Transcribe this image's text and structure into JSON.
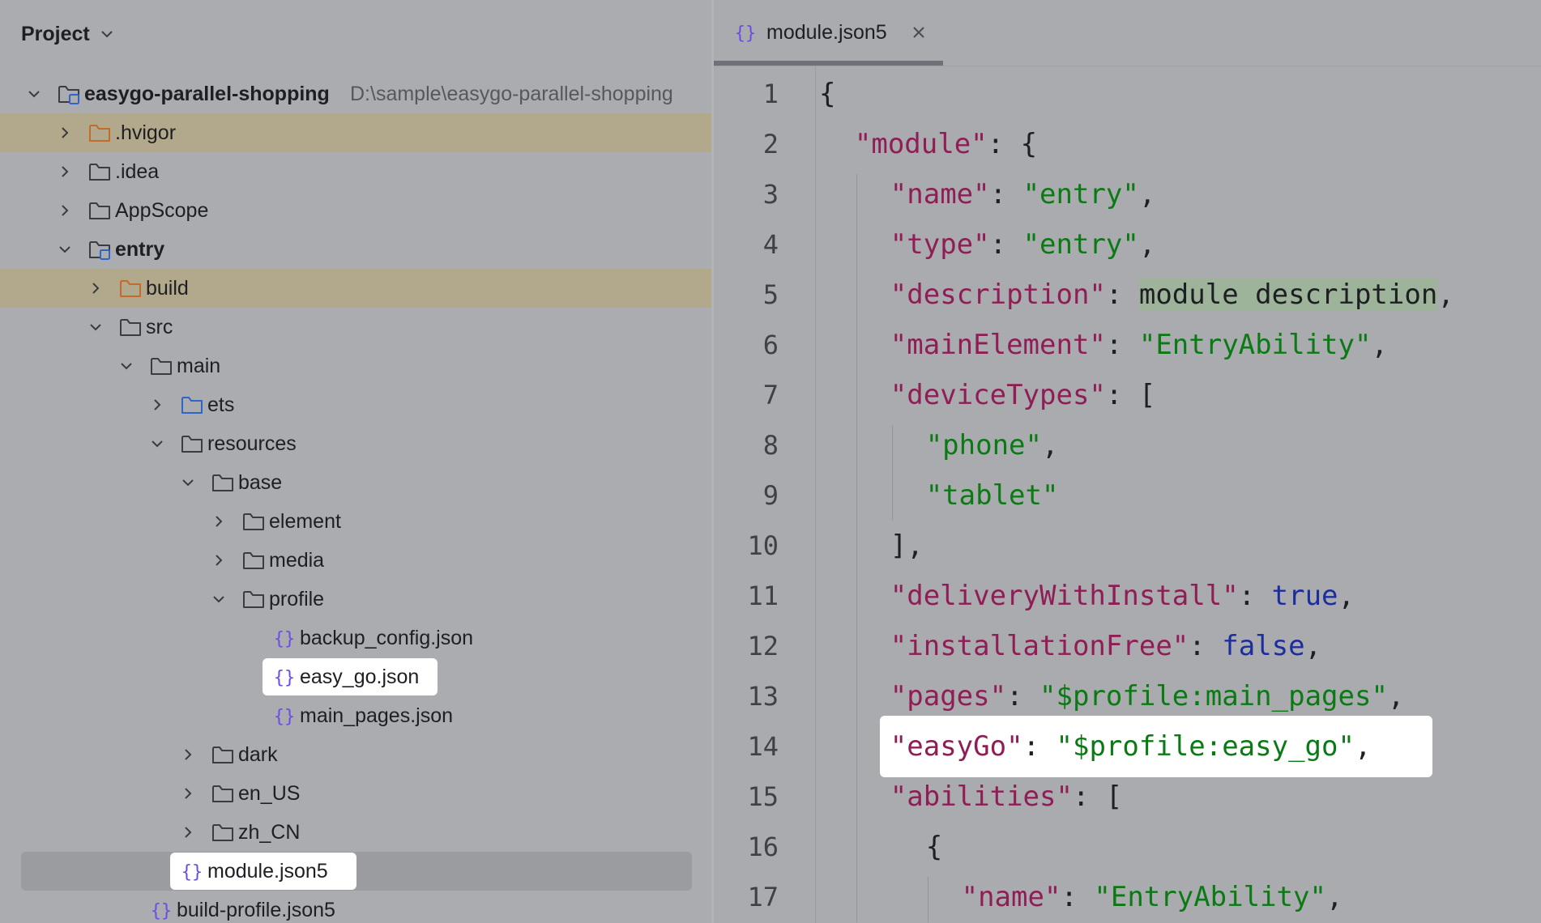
{
  "project_panel": {
    "title": "Project",
    "tree": [
      {
        "label": "easygo-parallel-shopping",
        "path": "D:\\sample\\easygo-parallel-shopping",
        "icon": "module-folder-icon",
        "expanded": true
      },
      {
        "label": ".hvigor",
        "icon": "excluded-folder-icon",
        "expanded": false
      },
      {
        "label": ".idea",
        "icon": "folder-icon",
        "expanded": false
      },
      {
        "label": "AppScope",
        "icon": "folder-icon",
        "expanded": false
      },
      {
        "label": "entry",
        "icon": "module-folder-icon",
        "expanded": true
      },
      {
        "label": "build",
        "icon": "excluded-folder-icon",
        "expanded": false
      },
      {
        "label": "src",
        "icon": "folder-icon",
        "expanded": true
      },
      {
        "label": "main",
        "icon": "folder-icon",
        "expanded": true
      },
      {
        "label": "ets",
        "icon": "source-folder-icon",
        "expanded": false
      },
      {
        "label": "resources",
        "icon": "folder-icon",
        "expanded": true
      },
      {
        "label": "base",
        "icon": "folder-icon",
        "expanded": true
      },
      {
        "label": "element",
        "icon": "folder-icon",
        "expanded": false
      },
      {
        "label": "media",
        "icon": "folder-icon",
        "expanded": false
      },
      {
        "label": "profile",
        "icon": "folder-icon",
        "expanded": true
      },
      {
        "label": "backup_config.json",
        "icon": "json-file-icon"
      },
      {
        "label": "easy_go.json",
        "icon": "json-file-icon",
        "highlighted": true
      },
      {
        "label": "main_pages.json",
        "icon": "json-file-icon"
      },
      {
        "label": "dark",
        "icon": "folder-icon",
        "expanded": false
      },
      {
        "label": "en_US",
        "icon": "folder-icon",
        "expanded": false
      },
      {
        "label": "zh_CN",
        "icon": "folder-icon",
        "expanded": false
      },
      {
        "label": "module.json5",
        "icon": "json-file-icon",
        "selected": true,
        "highlighted": true
      },
      {
        "label": "build-profile.json5",
        "icon": "json-file-icon"
      }
    ]
  },
  "editor": {
    "tab": {
      "label": "module.json5",
      "icon": "json-file-icon",
      "close": "×"
    },
    "line_numbers": [
      "1",
      "2",
      "3",
      "4",
      "5",
      "6",
      "7",
      "8",
      "9",
      "10",
      "11",
      "12",
      "13",
      "14",
      "15",
      "16",
      "17"
    ],
    "code": [
      {
        "t1": "{"
      },
      {
        "k": "\"module\"",
        "t1": ": {"
      },
      {
        "k": "\"name\"",
        "t1": ": ",
        "s": "\"entry\"",
        "t2": ","
      },
      {
        "k": "\"type\"",
        "t1": ": ",
        "s": "\"entry\"",
        "t2": ","
      },
      {
        "k": "\"description\"",
        "t1": ": ",
        "d": "module description",
        "t2": ","
      },
      {
        "k": "\"mainElement\"",
        "t1": ": ",
        "s": "\"EntryAbility\"",
        "t2": ","
      },
      {
        "k": "\"deviceTypes\"",
        "t1": ": ["
      },
      {
        "s": "\"phone\"",
        "t2": ","
      },
      {
        "s": "\"tablet\""
      },
      {
        "t1": "],"
      },
      {
        "k": "\"deliveryWithInstall\"",
        "t1": ": ",
        "kw": "true",
        "t2": ","
      },
      {
        "k": "\"installationFree\"",
        "t1": ": ",
        "kw": "false",
        "t2": ","
      },
      {
        "k": "\"pages\"",
        "t1": ": ",
        "s": "\"$profile:main_pages\"",
        "t2": ","
      },
      {
        "k": "\"easyGo\"",
        "t1": ": ",
        "s": "\"$profile:easy_go\"",
        "t2": ","
      },
      {
        "k": "\"abilities\"",
        "t1": ": ["
      },
      {
        "t1": "{"
      },
      {
        "k": "\"name\"",
        "t1": ": ",
        "s": "\"EntryAbility\"",
        "t2": ","
      }
    ]
  }
}
